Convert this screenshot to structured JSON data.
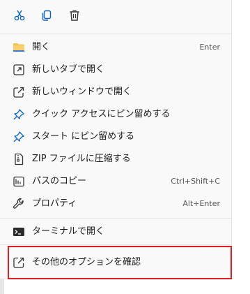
{
  "toolbar": {
    "cut_icon": "scissors-icon",
    "copy_icon": "copy-icon",
    "delete_icon": "trash-icon"
  },
  "menu": {
    "items": [
      {
        "label": "開く",
        "shortcut": "Enter",
        "icon": "folder-icon"
      },
      {
        "label": "新しいタブで開く",
        "shortcut": "",
        "icon": "open-new-tab-icon"
      },
      {
        "label": "新しいウィンドウで開く",
        "shortcut": "",
        "icon": "open-new-window-icon"
      },
      {
        "label": "クイック アクセスにピン留めする",
        "shortcut": "",
        "icon": "pin-icon"
      },
      {
        "label": "スタート にピン留めする",
        "shortcut": "",
        "icon": "pin-icon"
      },
      {
        "label": "ZIP ファイルに圧縮する",
        "shortcut": "",
        "icon": "zip-icon"
      },
      {
        "label": "パスのコピー",
        "shortcut": "Ctrl+Shift+C",
        "icon": "copy-path-icon"
      },
      {
        "label": "プロパティ",
        "shortcut": "Alt+Enter",
        "icon": "wrench-icon"
      },
      {
        "label": "ターミナルで開く",
        "shortcut": "",
        "icon": "terminal-icon"
      },
      {
        "label": "その他のオプションを確認",
        "shortcut": "",
        "icon": "more-options-icon"
      }
    ]
  },
  "colors": {
    "accent": "#0a63c9",
    "highlight": "#e02020",
    "folder": "#f2c14e"
  }
}
